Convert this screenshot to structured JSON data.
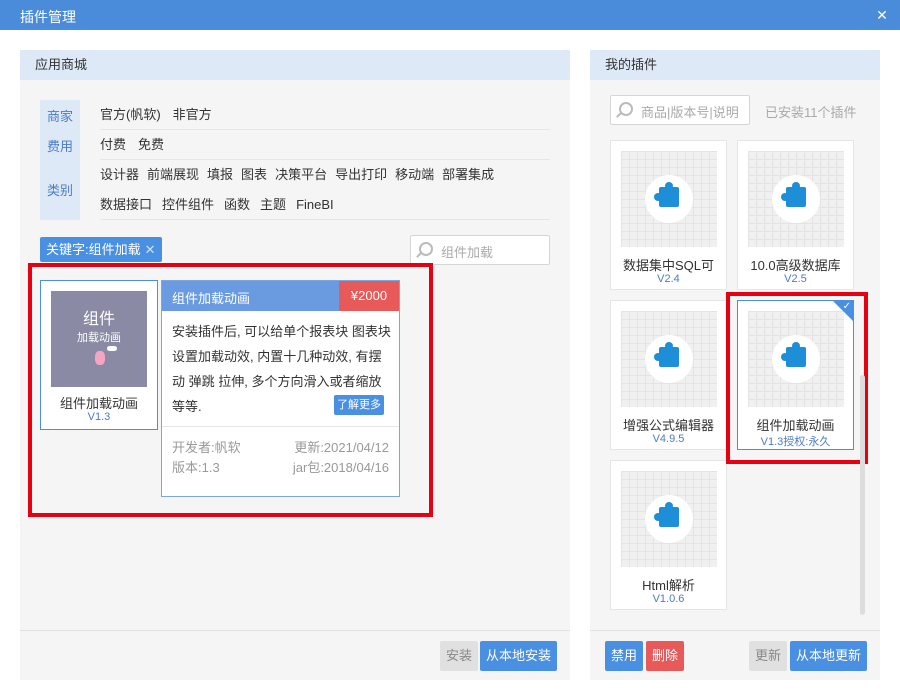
{
  "window": {
    "title": "插件管理",
    "close_label": "✕"
  },
  "store": {
    "header": "应用商城",
    "filters": {
      "labels": [
        "商家",
        "费用",
        "类别"
      ],
      "vendor": [
        "官方(帆软)",
        "非官方"
      ],
      "fee": [
        "付费",
        "免费"
      ],
      "category_row1": [
        "设计器",
        "前端展现",
        "填报",
        "图表",
        "决策平台",
        "导出打印",
        "移动端",
        "部署集成"
      ],
      "category_row2": [
        "数据接口",
        "控件组件",
        "函数",
        "主题",
        "FineBI"
      ]
    },
    "keyword_tag": "关键字:组件加载",
    "keyword_remove": "✕",
    "search_placeholder": "组件加载",
    "result_card": {
      "thumb_title": "组件",
      "thumb_subtitle": "加载动画",
      "name": "组件加载动画",
      "version": "V1.3"
    },
    "detail": {
      "title": "组件加载动画",
      "price": "¥2000",
      "description": "安装插件后, 可以给单个报表块 图表块设置加载动效, 内置十几种动效, 有摆动 弹跳 拉伸, 多个方向滑入或者缩放等等.",
      "learn_more": "了解更多",
      "developer": "开发者:帆软",
      "updated": "更新:2021/04/12",
      "version": "版本:1.3",
      "jar": "jar包:2018/04/16"
    },
    "footer": {
      "install": "安装",
      "install_local": "从本地安装"
    }
  },
  "mine": {
    "header": "我的插件",
    "search_placeholder": "商品|版本号|说明",
    "installed_count": "已安装11个插件",
    "plugins": [
      {
        "name": "数据集中SQL可",
        "version": "V2.4"
      },
      {
        "name": "10.0高级数据库",
        "version": "V2.5"
      },
      {
        "name": "增强公式编辑器",
        "version": "V4.9.5"
      },
      {
        "name": "组件加载动画",
        "version": "V1.3授权:永久"
      },
      {
        "name": "Html解析",
        "version": "V1.0.6"
      }
    ],
    "footer": {
      "disable": "禁用",
      "delete": "删除",
      "update": "更新",
      "update_local": "从本地更新"
    }
  },
  "colors": {
    "accent": "#4a90e2",
    "danger": "#e85a5a",
    "highlight": "#e60012",
    "titlebar": "#4a8cd9"
  }
}
